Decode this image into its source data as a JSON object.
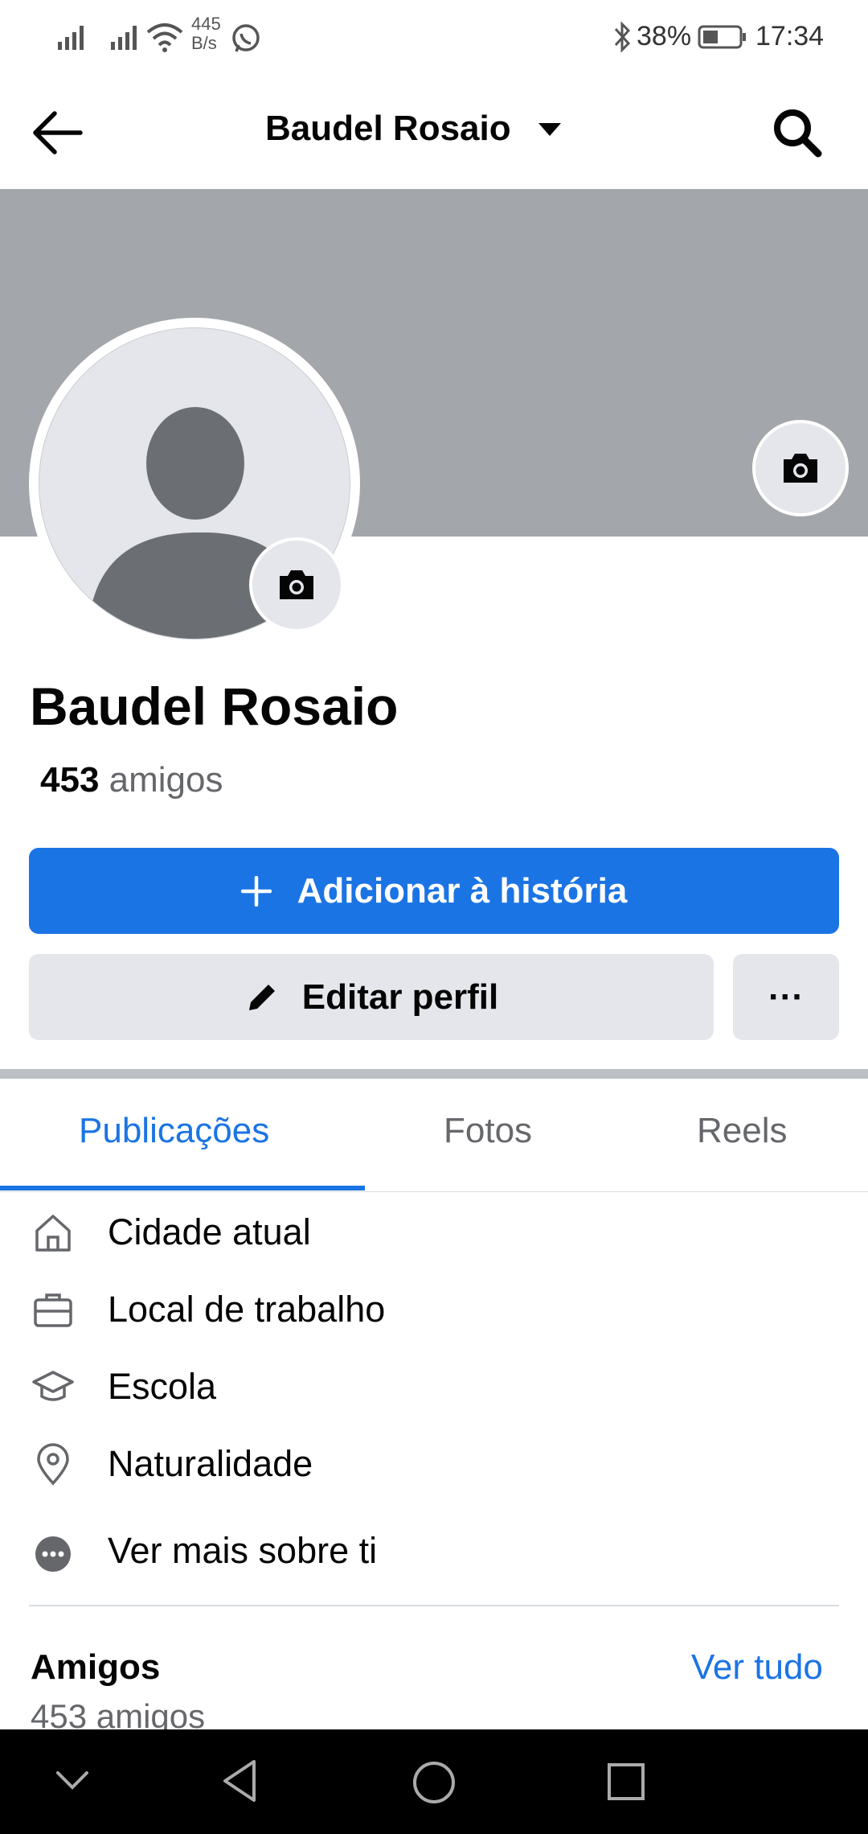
{
  "status_bar": {
    "net_speed_value": "445",
    "net_speed_unit": "B/s",
    "battery": "38%",
    "time": "17:34"
  },
  "header": {
    "title": "Baudel Rosaio"
  },
  "profile": {
    "name": "Baudel Rosaio",
    "friends_count": "453",
    "friends_word": "amigos"
  },
  "actions": {
    "add_story": "Adicionar à história",
    "edit_profile": "Editar perfil",
    "more": "···"
  },
  "tabs": [
    {
      "label": "Publicações",
      "active": true
    },
    {
      "label": "Fotos",
      "active": false
    },
    {
      "label": "Reels",
      "active": false
    }
  ],
  "about": [
    {
      "icon": "home-icon",
      "label": "Cidade atual"
    },
    {
      "icon": "briefcase-icon",
      "label": "Local de trabalho"
    },
    {
      "icon": "graduation-cap-icon",
      "label": "Escola"
    },
    {
      "icon": "location-pin-icon",
      "label": "Naturalidade"
    },
    {
      "icon": "more-dots-icon",
      "label": "Ver mais sobre ti"
    }
  ],
  "friends_section": {
    "title": "Amigos",
    "see_all": "Ver tudo",
    "count_text": "453 amigos"
  },
  "colors": {
    "accent": "#1b74e4",
    "cover": "#a3a6aa",
    "button_gray": "#e4e6eb"
  }
}
